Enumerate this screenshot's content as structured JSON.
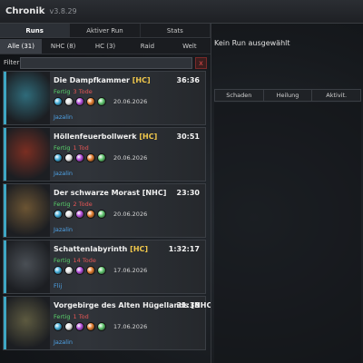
{
  "app": {
    "title": "Chronik",
    "version": "v3.8.29"
  },
  "tabs": [
    {
      "label": "Runs",
      "active": true
    },
    {
      "label": "Aktiver Run",
      "active": false
    },
    {
      "label": "Stats",
      "active": false
    }
  ],
  "subtabs": [
    {
      "label": "Alle (31)",
      "active": true
    },
    {
      "label": "NHC (8)",
      "active": false
    },
    {
      "label": "HC (3)",
      "active": false
    },
    {
      "label": "Raid",
      "active": false
    },
    {
      "label": "Welt",
      "active": false
    }
  ],
  "filter": {
    "label": "Filter:",
    "value": "",
    "clear_label": "x"
  },
  "runs": [
    {
      "name": "Die Dampfkammer",
      "tag": "[HC]",
      "time": "36:36",
      "status": "Fertig",
      "deaths": "3 Tode",
      "date": "20.06.2026",
      "player": "Jazalin",
      "art": "#2f6b7a"
    },
    {
      "name": "Höllenfeuerbollwerk",
      "tag": "[HC]",
      "time": "30:51",
      "status": "Fertig",
      "deaths": "1 Tod",
      "date": "20.06.2026",
      "player": "Jazalin",
      "art": "#7a2e22"
    },
    {
      "name": "Der schwarze Morast [NHC]",
      "tag": "",
      "time": "23:30",
      "status": "Fertig",
      "deaths": "2 Tode",
      "date": "20.06.2026",
      "player": "Jazalin",
      "art": "#6b5433"
    },
    {
      "name": "Schattenlabyrinth",
      "tag": "[HC]",
      "time": "1:32:17",
      "status": "Fertig",
      "deaths": "14 Tode",
      "date": "17.06.2026",
      "player": "Flij",
      "art": "#4a4f55"
    },
    {
      "name": "Vorgebirge des Alten Hügellands [NHC]",
      "tag": "",
      "time": "31:38",
      "status": "Fertig",
      "deaths": "1 Tod",
      "date": "17.06.2026",
      "player": "Jazalin",
      "art": "#5d5a40"
    }
  ],
  "affix_colors": [
    "#3fa9d6",
    "#e2e2e2",
    "#b04ad8",
    "#e07a2c",
    "#5bc26a"
  ],
  "right": {
    "no_run": "Kein Run ausgewählt",
    "stat_tabs": [
      "Schaden",
      "Heilung",
      "Aktivit."
    ]
  }
}
